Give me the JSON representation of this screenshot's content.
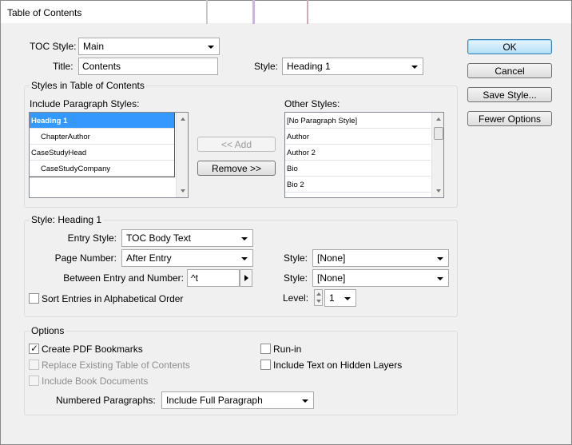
{
  "window": {
    "title": "Table of Contents"
  },
  "toc_style": {
    "label": "TOC Style:",
    "value": "Main"
  },
  "title": {
    "label": "Title:",
    "value": "Contents"
  },
  "title_style": {
    "label": "Style:",
    "value": "Heading 1"
  },
  "styles_group": {
    "label": "Styles in Table of Contents",
    "include_label": "Include Paragraph Styles:",
    "include_items": [
      {
        "label": "Heading 1",
        "selected": true,
        "indent": false
      },
      {
        "label": "ChapterAuthor",
        "selected": false,
        "indent": true
      },
      {
        "label": "CaseStudyHead",
        "selected": false,
        "indent": false
      },
      {
        "label": "CaseStudyCompany",
        "selected": false,
        "indent": true
      }
    ],
    "add_label": "<< Add",
    "remove_label": "Remove >>",
    "other_label": "Other Styles:",
    "other_items": [
      "[No Paragraph Style]",
      "Author",
      "Author 2",
      "Bio",
      "Bio 2"
    ]
  },
  "style_group": {
    "label": "Style: Heading 1",
    "entry_style": {
      "label": "Entry Style:",
      "value": "TOC Body Text"
    },
    "page_number": {
      "label": "Page Number:",
      "value": "After Entry"
    },
    "page_number_style": {
      "label": "Style:",
      "value": "[None]"
    },
    "between": {
      "label": "Between Entry and Number:",
      "value": "^t"
    },
    "between_style": {
      "label": "Style:",
      "value": "[None]"
    },
    "sort_label": "Sort Entries in Alphabetical Order",
    "level": {
      "label": "Level:",
      "value": "1"
    }
  },
  "options_group": {
    "label": "Options",
    "create_pdf": {
      "label": "Create PDF Bookmarks",
      "checked": true
    },
    "replace_existing": {
      "label": "Replace Existing Table of Contents",
      "checked": false
    },
    "include_book": {
      "label": "Include Book Documents",
      "checked": false
    },
    "run_in": {
      "label": "Run-in",
      "checked": false
    },
    "include_hidden": {
      "label": "Include Text on Hidden Layers",
      "checked": false
    },
    "numbered": {
      "label": "Numbered Paragraphs:",
      "value": "Include Full Paragraph"
    }
  },
  "buttons": {
    "ok": "OK",
    "cancel": "Cancel",
    "save_style": "Save Style...",
    "fewer_options": "Fewer Options"
  }
}
